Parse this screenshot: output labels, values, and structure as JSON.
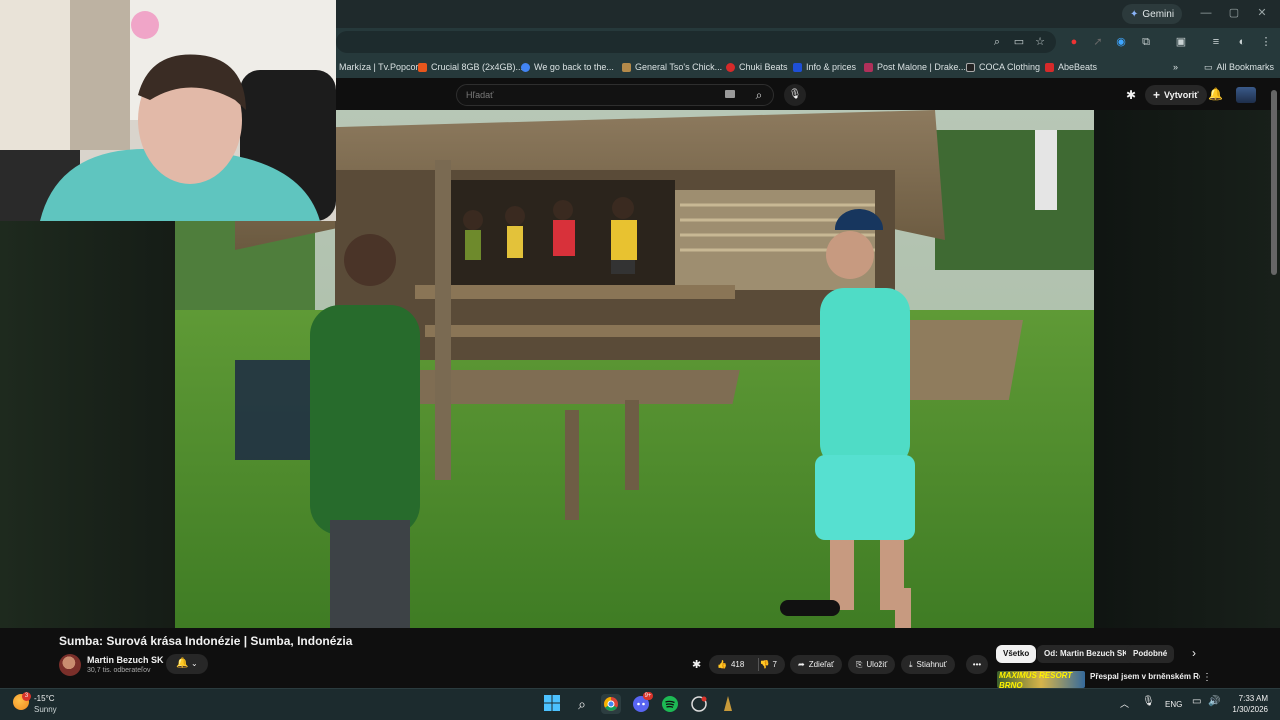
{
  "browser": {
    "gemini_label": "Gemini",
    "window_controls": [
      "—",
      "▢",
      "✕"
    ],
    "bookmarks": [
      {
        "label": "Markíza | Tv.Popcor...",
        "color": "#1e6bd6"
      },
      {
        "label": "Crucial 8GB (2x4GB)...",
        "color": "#e8561c"
      },
      {
        "label": "We go back to the...",
        "color": "#4285f4"
      },
      {
        "label": "General Tso's Chick...",
        "color": "#b48a4a"
      },
      {
        "label": "Chuki Beats",
        "color": "#d62a2a"
      },
      {
        "label": "Info & prices",
        "color": "#1e4fd6"
      },
      {
        "label": "Post Malone | Drake...",
        "color": "#b0305a"
      },
      {
        "label": "COCA Clothing",
        "color": "#222222"
      },
      {
        "label": "AbeBeats",
        "color": "#d62a2a"
      }
    ],
    "more_bookmarks": "»",
    "all_bookmarks": "All Bookmarks"
  },
  "youtube": {
    "search_placeholder": "Hľadať",
    "create_label": "Vytvoriť",
    "video_title": "Sumba: Surová krása Indonézie | Sumba, Indonézia",
    "channel_name": "Martin Bezuch SK",
    "subscribers": "30,7 tis. odberateľov",
    "likes": "418",
    "dislikes": "7",
    "share_label": "Zdieľať",
    "save_label": "Uložiť",
    "download_label": "Stiahnuť",
    "more_label": "•••",
    "chips": [
      "Všetko",
      "Od: Martin Bezuch SK",
      "Podobné"
    ],
    "rec_thumb_text": "MAXIMUS RESORT BRNO",
    "rec_title": "Přespal jsem v brněnském Resortu Maximus | Bez slevy"
  },
  "taskbar": {
    "temperature": "-15°C",
    "condition": "Sunny",
    "weather_badge": "3",
    "language": "ENG",
    "time": "7:33 AM",
    "date": "1/30/2026",
    "discord_badge": "9+"
  },
  "colors": {
    "accent": "#3ea6ff",
    "taskbar": "#1c2b2e",
    "chrome_toolbar": "#26393b"
  }
}
